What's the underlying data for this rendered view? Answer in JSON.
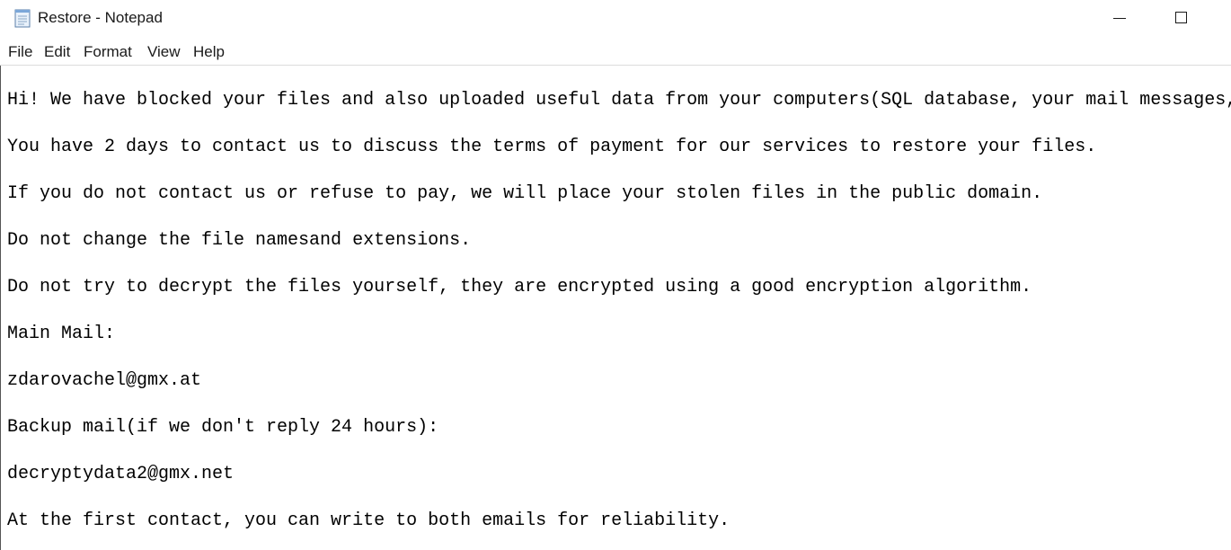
{
  "window": {
    "title": "Restore - Notepad",
    "app_icon": "notepad-icon",
    "controls": {
      "minimize_icon": "minimize-icon",
      "maximize_icon": "maximize-icon"
    }
  },
  "menu": {
    "file": "File",
    "edit": "Edit",
    "format": "Format",
    "view": "View",
    "help": "Help"
  },
  "document": {
    "lines": [
      "Hi! We have blocked your files and also uploaded useful data from your computers(SQL database, your mail messages,",
      "You have 2 days to contact us to discuss the terms of payment for our services to restore your files.",
      "If you do not contact us or refuse to pay, we will place your stolen files in the public domain.",
      "Do not change the file namesand extensions.",
      "Do not try to decrypt the files yourself, they are encrypted using a good encryption algorithm.",
      "Main Mail:",
      "zdarovachel@gmx.at",
      "Backup mail(if we don't reply 24 hours):",
      "decryptydata2@gmx.net",
      "At the first contact, you can write to both emails for reliability."
    ]
  }
}
